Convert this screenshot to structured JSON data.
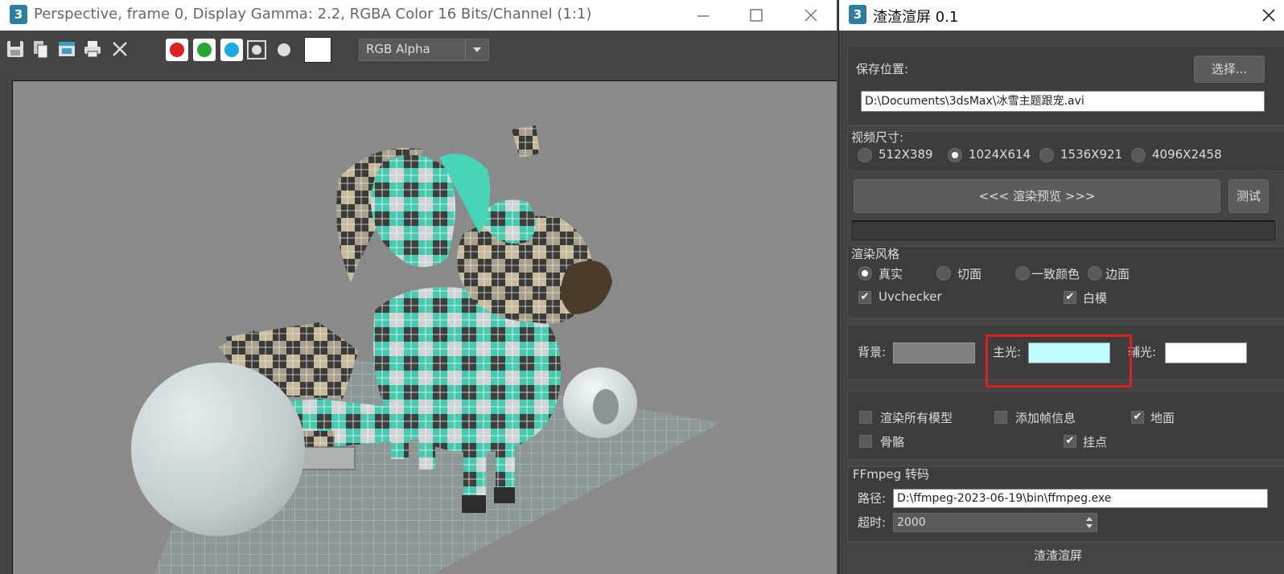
{
  "render_window": {
    "title": "Perspective, frame 0, Display Gamma: 2.2, RGBA Color 16 Bits/Channel (1:1)",
    "channel_dropdown": "RGB Alpha"
  },
  "panel": {
    "title": "渣渣渲屏 0.1",
    "save": {
      "label": "保存位置:",
      "choose_button": "选择...",
      "path": "D:\\Documents\\3dsMax\\冰雪主题跟宠.avi"
    },
    "video_size": {
      "label": "视频尺寸:",
      "options": [
        "512X389",
        "1024X614",
        "1536X921",
        "4096X2458"
      ],
      "selected": "1024X614"
    },
    "preview_button": "<<<  渲染预览  >>>",
    "test_button": "测试",
    "style": {
      "label": "渲染风格",
      "options": [
        "真实",
        "切面",
        "一致颜色",
        "边面"
      ],
      "selected": "真实",
      "uvchecker": "Uvchecker",
      "white_model": "白模"
    },
    "lights": {
      "bg_label": "背景:",
      "main_label": "主光:",
      "fill_label": "辅光:",
      "bg_color": "#808080",
      "main_color": "#bffcff",
      "fill_color": "#ffffff",
      "highlight_color": "#e02020"
    },
    "options": {
      "render_all": "渲染所有模型",
      "frame_info": "添加帧信息",
      "ground": "地面",
      "bones": "骨骼",
      "helpers": "挂点"
    },
    "ffmpeg": {
      "label": "FFmpeg 转码",
      "path_label": "路径:",
      "path": "D:\\ffmpeg-2023-06-19\\bin\\ffmpeg.exe",
      "timeout_label": "超时:",
      "timeout": "2000"
    },
    "footer": "渣渣渲屏"
  }
}
